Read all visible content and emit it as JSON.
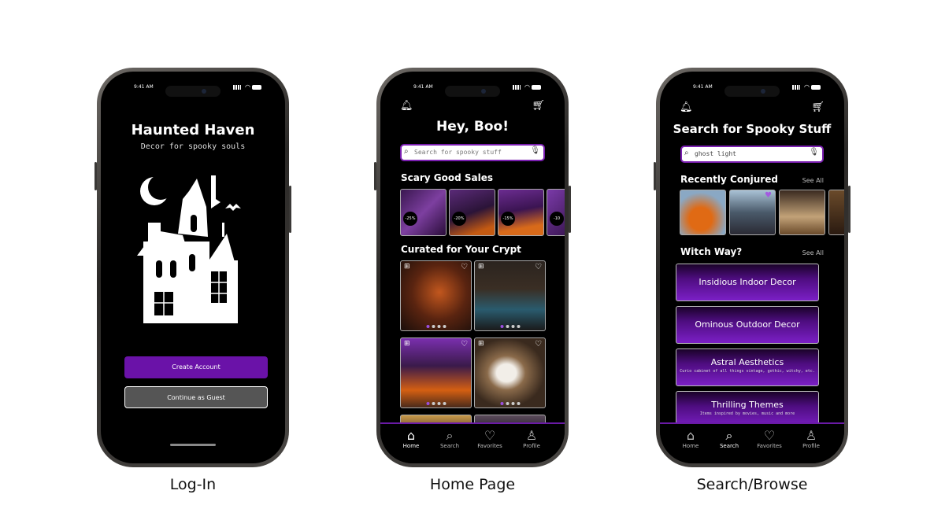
{
  "status": {
    "time": "9:41 AM"
  },
  "login": {
    "title": "Haunted Haven",
    "subtitle": "Decor for spooky souls",
    "create_account": "Create Account",
    "guest": "Continue as Guest",
    "label": "Log-In"
  },
  "home": {
    "greeting": "Hey, Boo!",
    "search_placeholder": "Search for spooky stuff",
    "sales_title": "Scary Good Sales",
    "sales_badges": [
      "-25%",
      "-20%",
      "-15%",
      "-10"
    ],
    "curated_title": "Curated for Your Crypt",
    "label": "Home Page"
  },
  "search": {
    "title": "Search for Spooky Stuff",
    "query": "ghost light",
    "recent_title": "Recently Conjured",
    "see_all": "See All",
    "witch_title": "Witch Way?",
    "categories": [
      {
        "title": "Insidious Indoor Decor",
        "sub": ""
      },
      {
        "title": "Ominous Outdoor Decor",
        "sub": ""
      },
      {
        "title": "Astral Aesthetics",
        "sub": "Curio cabinet of all things vintage, gothic, witchy, etc."
      },
      {
        "title": "Thrilling Themes",
        "sub": "Items inspired by movies, music and more"
      }
    ],
    "label": "Search/Browse"
  },
  "tabs": [
    "Home",
    "Search",
    "Favorites",
    "Profile"
  ],
  "colors": {
    "accent": "#6a12a8",
    "border": "#7a1fb0",
    "guest_btn": "#555555"
  },
  "icons": {
    "bell": "bell-icon",
    "cart": "cart-icon",
    "home": "home-icon",
    "search": "search-icon",
    "heart": "heart-icon",
    "profile": "profile-icon",
    "mic": "mic-icon"
  }
}
